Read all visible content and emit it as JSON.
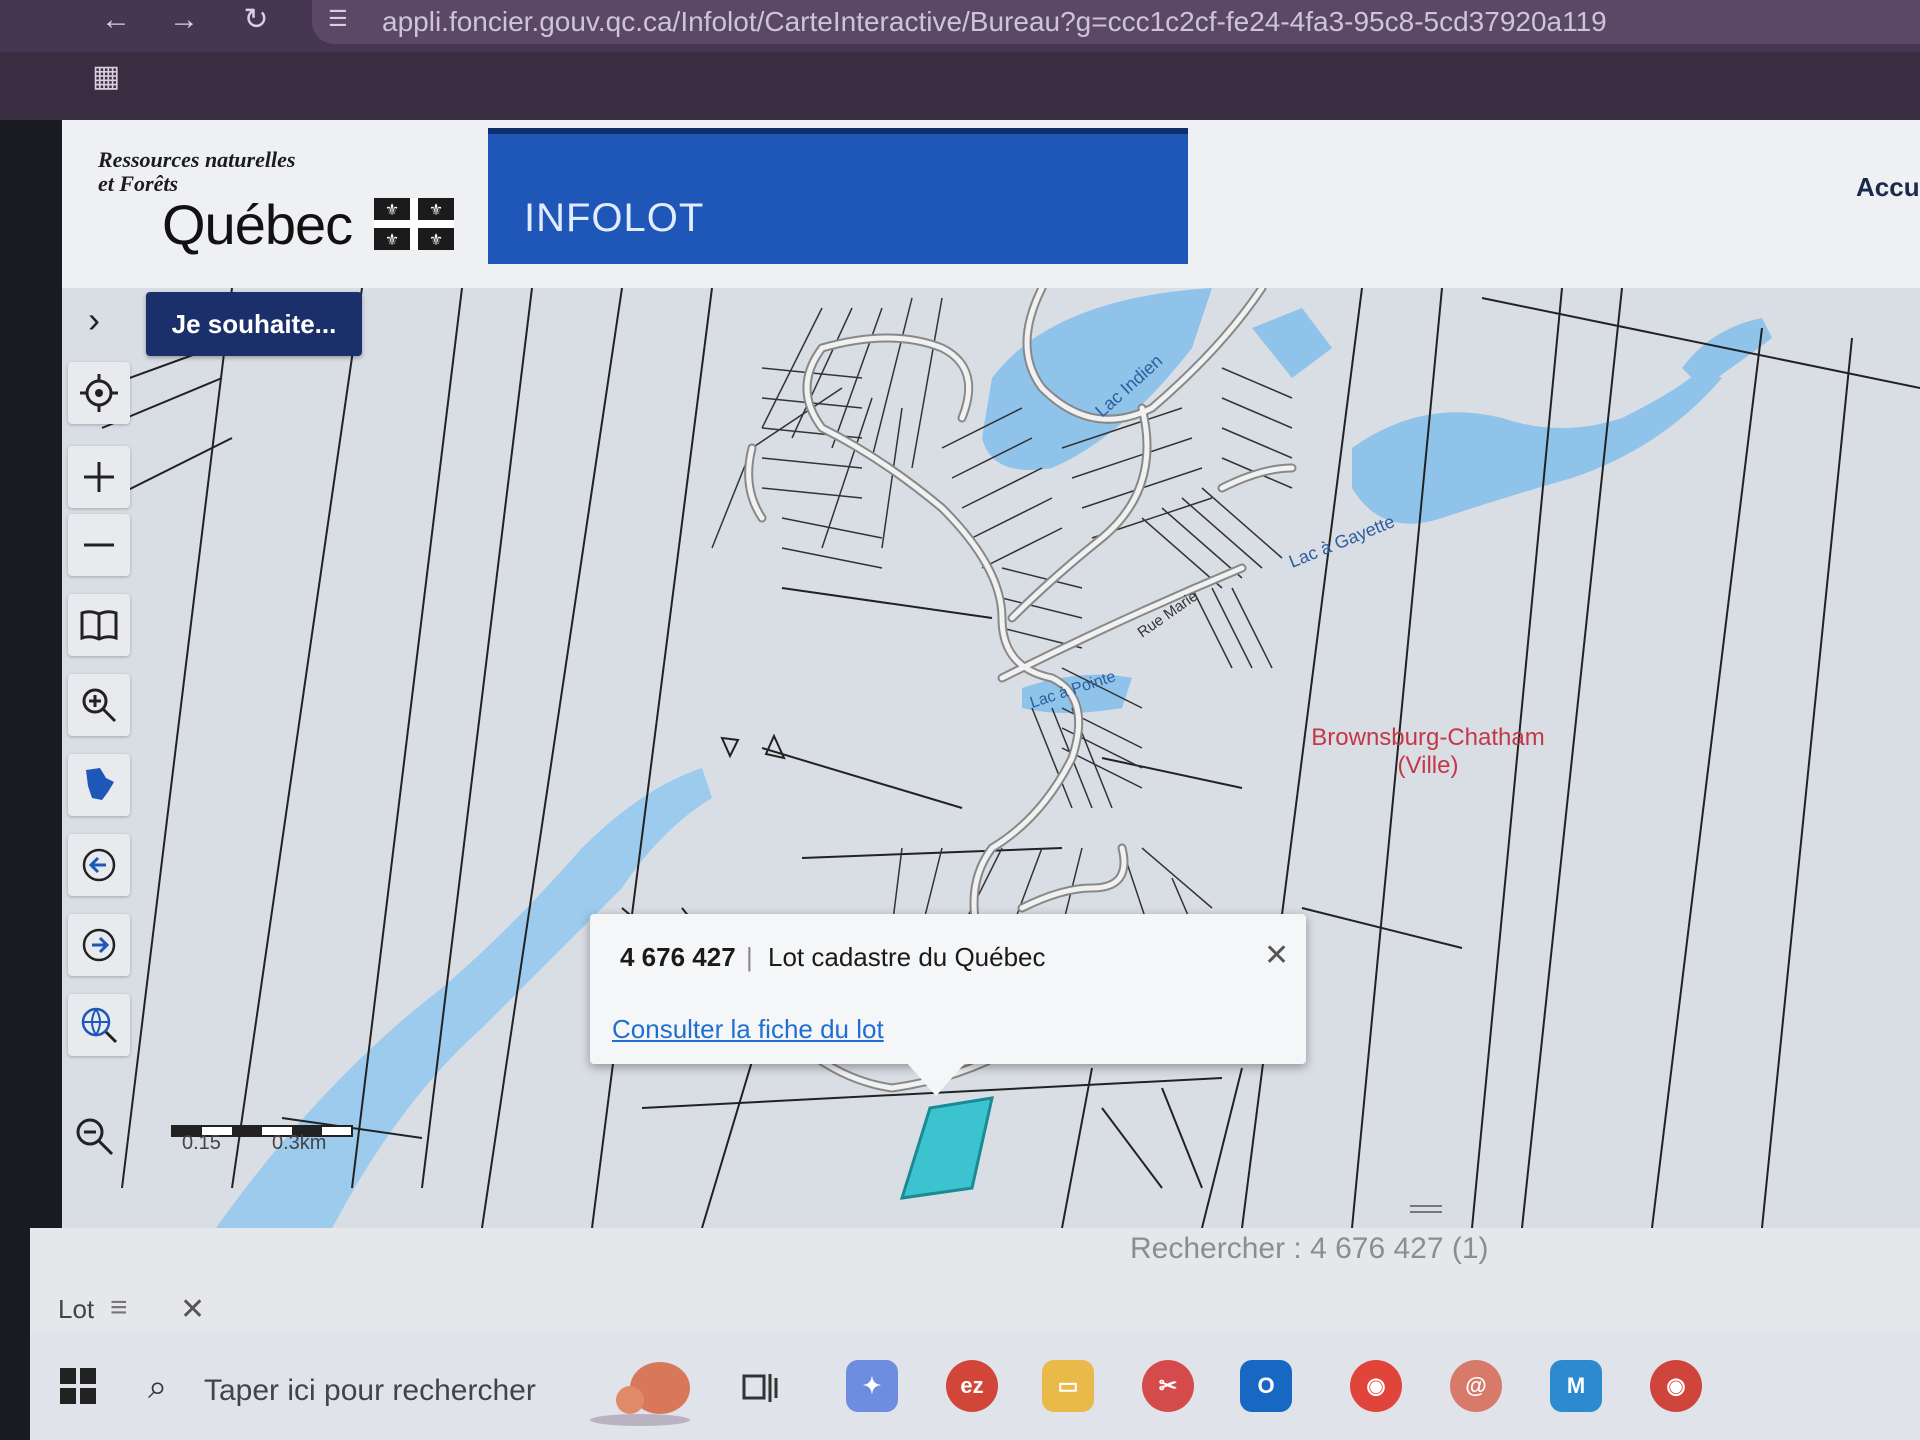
{
  "browser": {
    "url": "appli.foncier.gouv.qc.ca/Infolot/CarteInteractive/Bureau?g=ccc1c2cf-fe24-4fa3-95c8-5cd37920a119",
    "back_icon": "arrow-left-icon",
    "forward_icon": "arrow-right-icon",
    "reload_icon": "reload-icon"
  },
  "header": {
    "ministry": "Ressources naturelles\net Forêts",
    "quebec": "Québec",
    "app_title": "INFOLOT",
    "home_link": "Accu"
  },
  "map": {
    "je_souhaite": "Je souhaite...",
    "lakes": [
      "Lac Indien",
      "Lac à Gayette",
      "Lac à Pointe"
    ],
    "street": "Rue Marie",
    "municipality": "Brownsburg-Chatham\n(Ville)",
    "scale_labels": [
      "0.15",
      "0.3km"
    ],
    "tools": [
      "locate-icon",
      "zoom-in-icon",
      "zoom-out-icon",
      "book-icon",
      "zoom-area-icon",
      "quebec-map-icon",
      "previous-extent-icon",
      "next-extent-icon",
      "globe-search-icon",
      "zoom-extent-icon"
    ]
  },
  "popup": {
    "lot_number": "4 676 427",
    "separator": "|",
    "lot_type": "Lot cadastre du Québec",
    "link": "Consulter la fiche du lot"
  },
  "results": {
    "search_text": "Rechercher : 4 676 427 (1)",
    "tab_label": "Lot"
  },
  "taskbar": {
    "search_placeholder": "Taper ici pour rechercher",
    "apps": [
      "copilot",
      "ez",
      "file-explorer",
      "snipping-tool",
      "outlook",
      "chrome",
      "app-swirl",
      "microsoft-365",
      "chrome-profile"
    ]
  },
  "colors": {
    "water": "#8fc3ea",
    "selected_lot": "#3cc3d0",
    "municipality_text": "#c33848",
    "infolot_bar": "#1e57b8",
    "button_dark": "#1b2f6b"
  }
}
